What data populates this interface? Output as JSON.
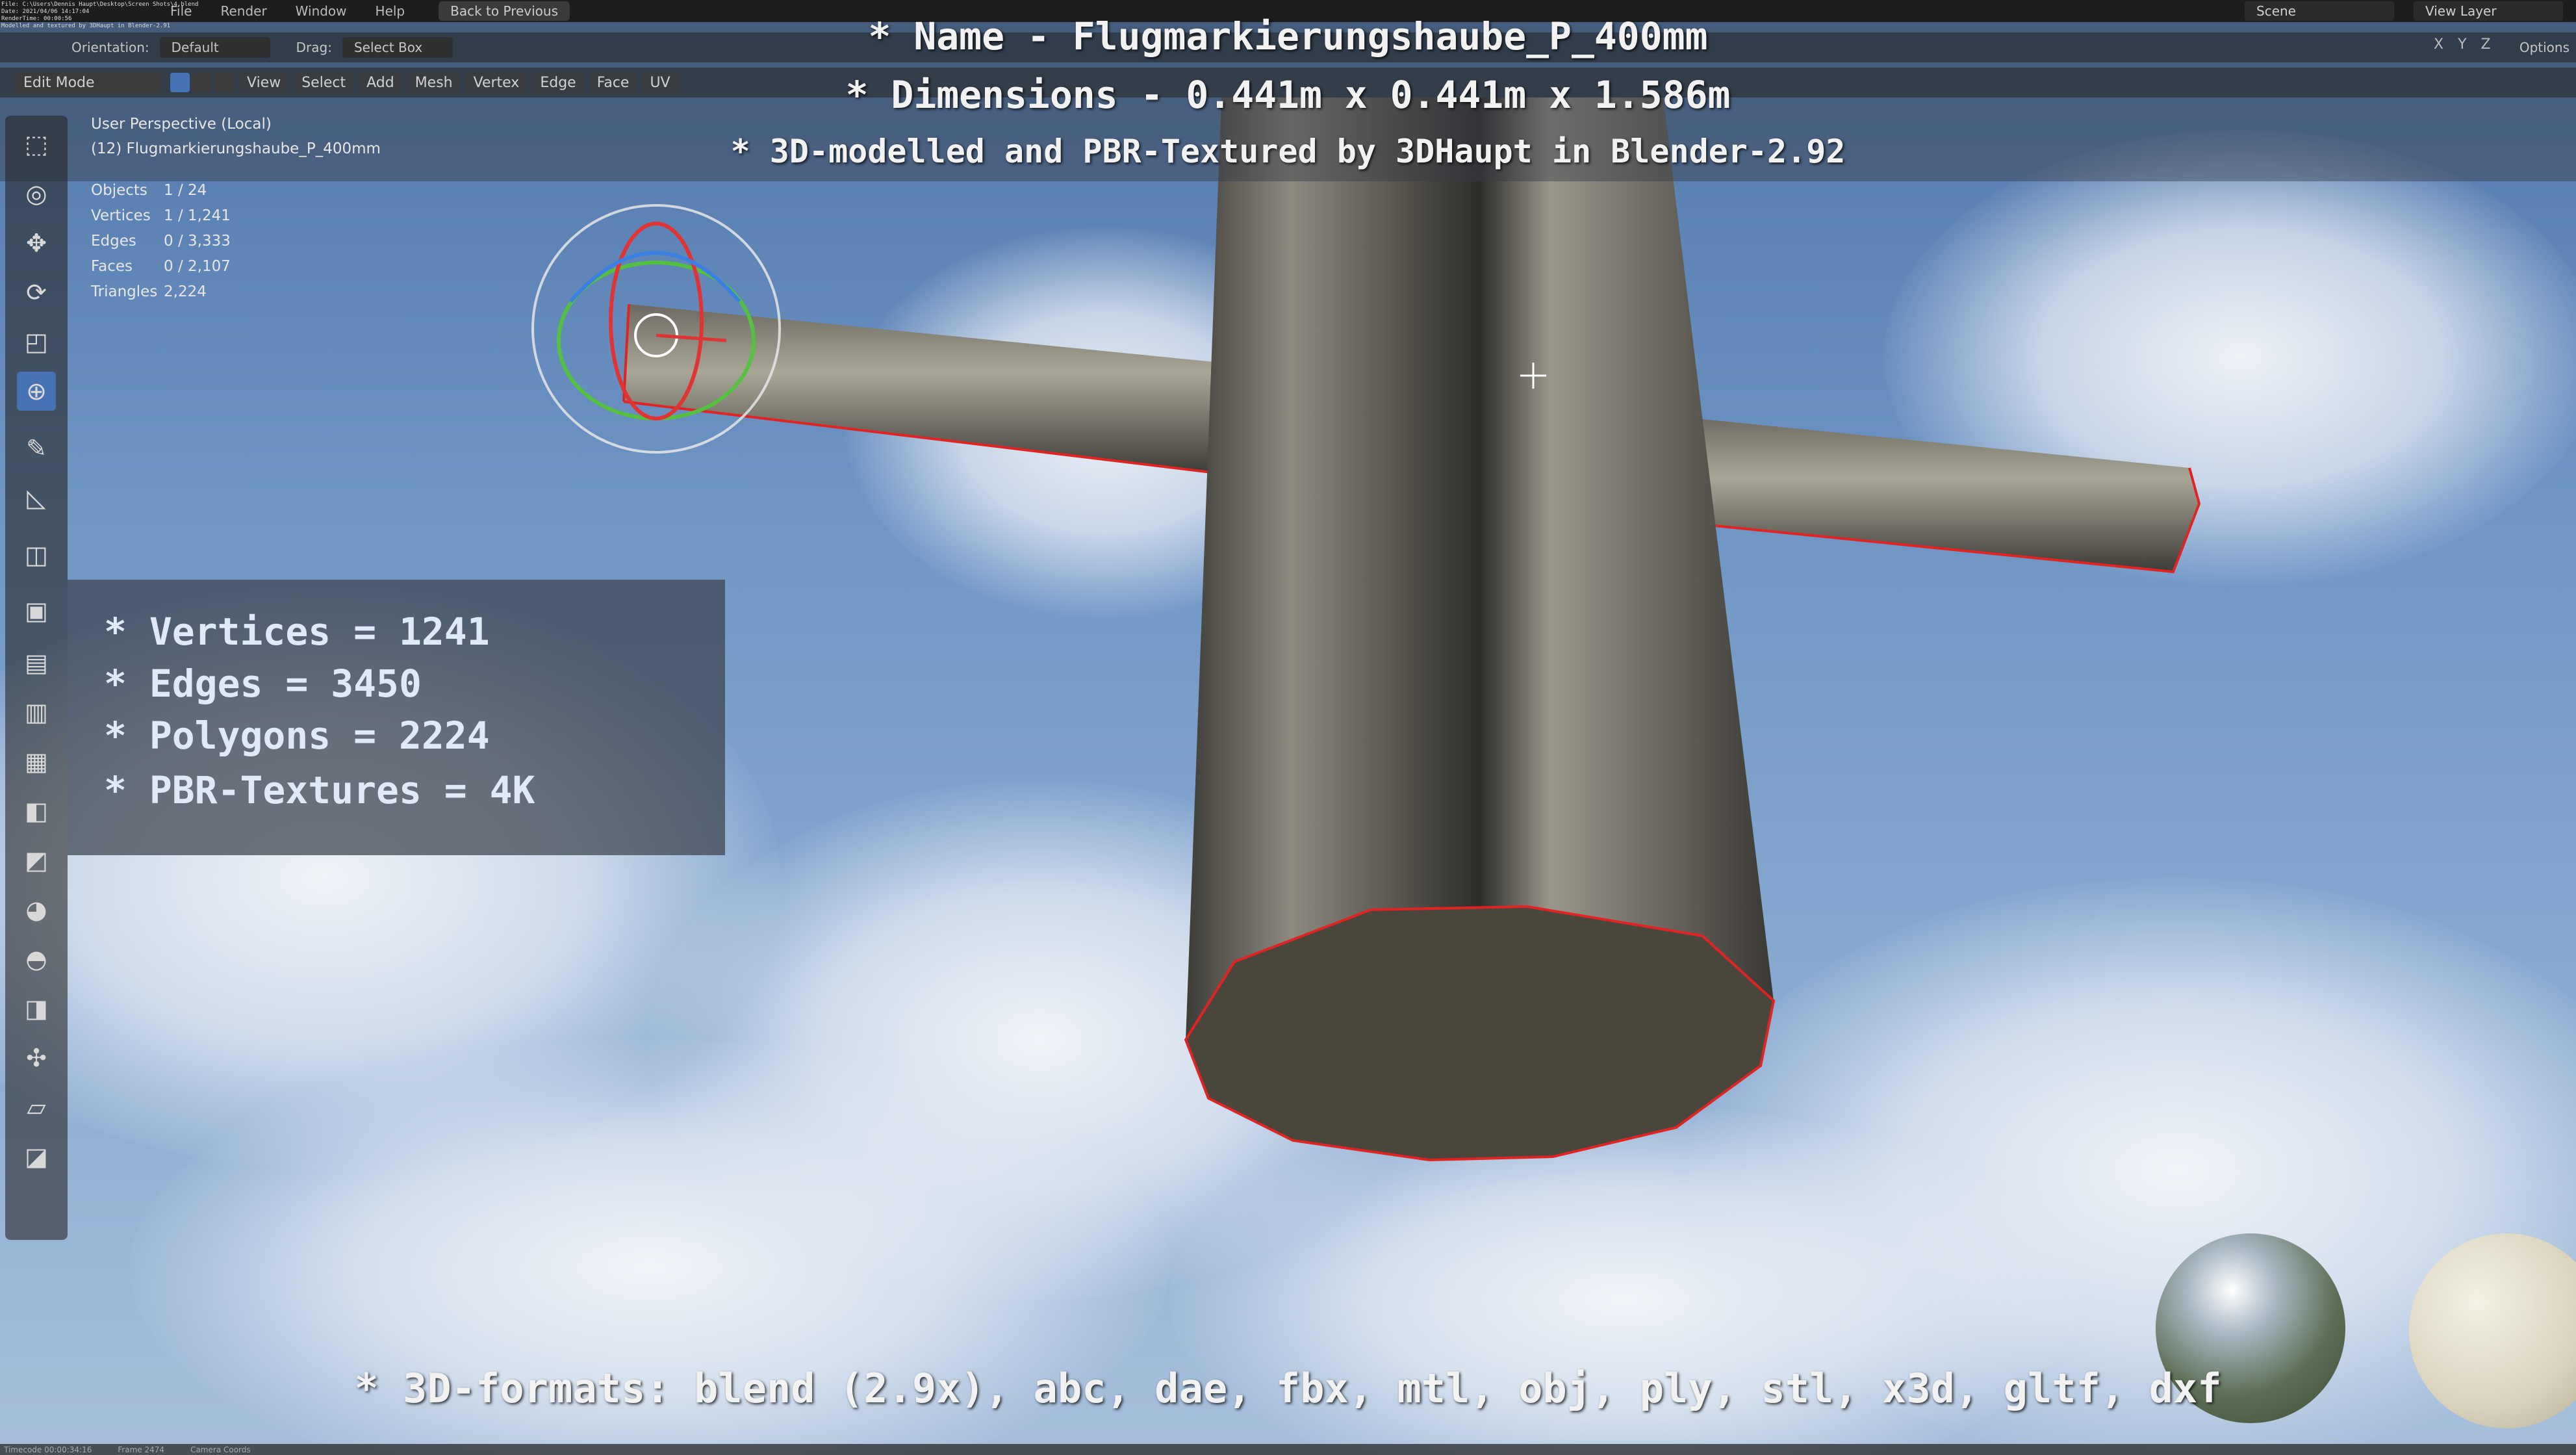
{
  "file_info": {
    "lines": [
      "File: C:\\Users\\Dennis Haupt\\Desktop\\Screen Shots\\4.blend",
      "Date: 2021/04/06 14:17:04",
      "RenderTime: 00:00:56",
      "Modelled and textured by 3DHaupt in Blender-2.91"
    ]
  },
  "topbar": {
    "menu": [
      "File",
      "Render",
      "Window",
      "Help"
    ],
    "back_button": "Back to Previous",
    "scene_label": "Scene",
    "view_layer_label": "View Layer"
  },
  "tool_settings": {
    "orientation_label": "Orientation:",
    "orientation_value": "Default",
    "drag_label": "Drag:",
    "drag_value": "Select Box",
    "options_label": "Options"
  },
  "header3d": {
    "mode": "Edit Mode",
    "menus": [
      "View",
      "Select",
      "Add",
      "Mesh",
      "Vertex",
      "Edge",
      "Face",
      "UV"
    ]
  },
  "viewport_info": {
    "perspective": "User Perspective (Local)",
    "object_name": "(12) Flugmarkierungshaube_P_400mm"
  },
  "stats": [
    {
      "label": "Objects",
      "value": "1 / 24"
    },
    {
      "label": "Vertices",
      "value": "1 / 1,241"
    },
    {
      "label": "Edges",
      "value": "0 / 3,333"
    },
    {
      "label": "Faces",
      "value": "0 / 2,107"
    },
    {
      "label": "Triangles",
      "value": "2,224"
    }
  ],
  "overlay": {
    "name_line": "* Name - Flugmarkierungshaube_P_400mm",
    "dimensions_line": "* Dimensions -  0.441m x 0.441m x 1.586m",
    "credit_line": "* 3D-modelled and PBR-Textured by 3DHaupt in Blender-2.92",
    "spec_lines": [
      "* Vertices = 1241",
      "* Edges = 3450",
      "* Polygons = 2224",
      "* PBR-Textures = 4K"
    ],
    "formats_line": "* 3D-formats: blend (2.9x), abc, dae, fbx, mtl, obj, ply, stl, x3d, gltf, dxf"
  },
  "axes": [
    "X",
    "Y",
    "Z"
  ],
  "statusbar": [
    "Timecode 00:00:34:16",
    "Frame 2474",
    "Camera Coords"
  ],
  "colors": {
    "selection_edge": "#e02424",
    "active_tool": "#4772b3",
    "sky": "#6e95c4"
  }
}
